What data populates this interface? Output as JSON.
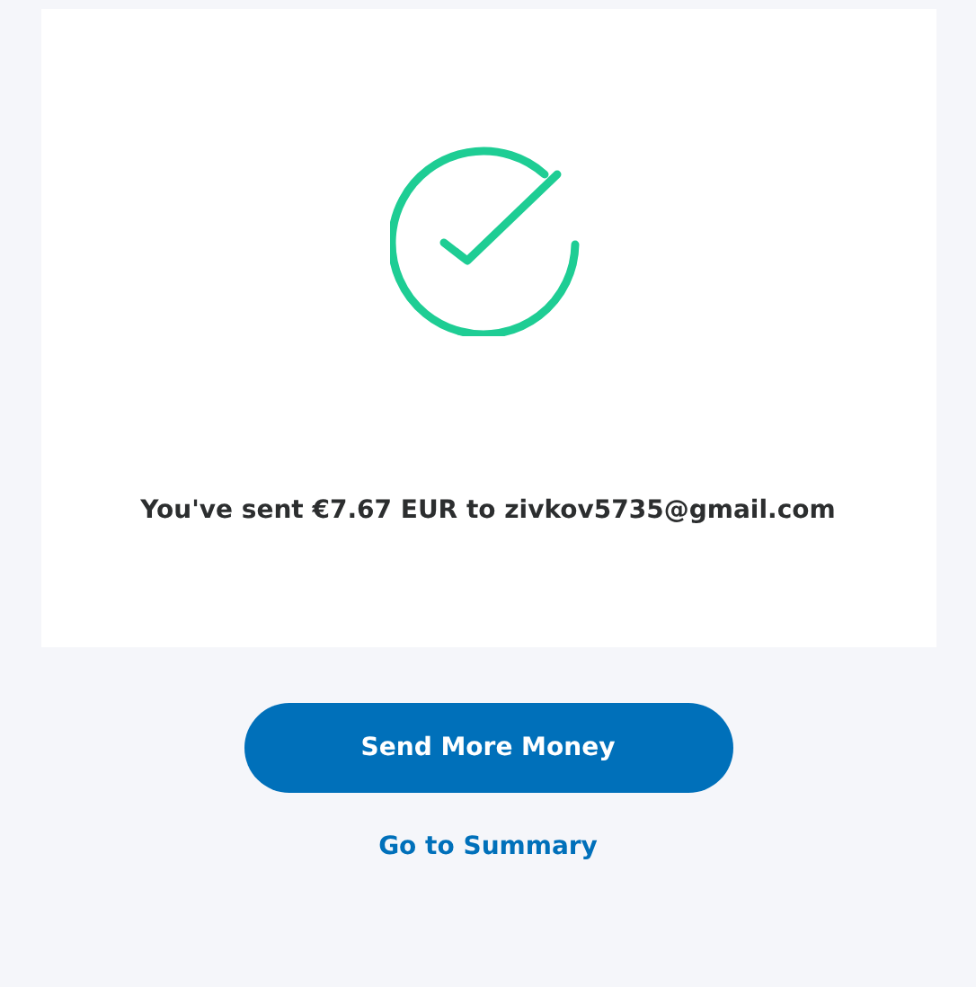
{
  "confirmation": {
    "message": "You've sent €7.67 EUR to zivkov5735@gmail.com"
  },
  "actions": [
    {
      "kind": "primary",
      "label": "Send More Money"
    },
    {
      "kind": "link",
      "label": "Go to Summary"
    }
  ]
}
